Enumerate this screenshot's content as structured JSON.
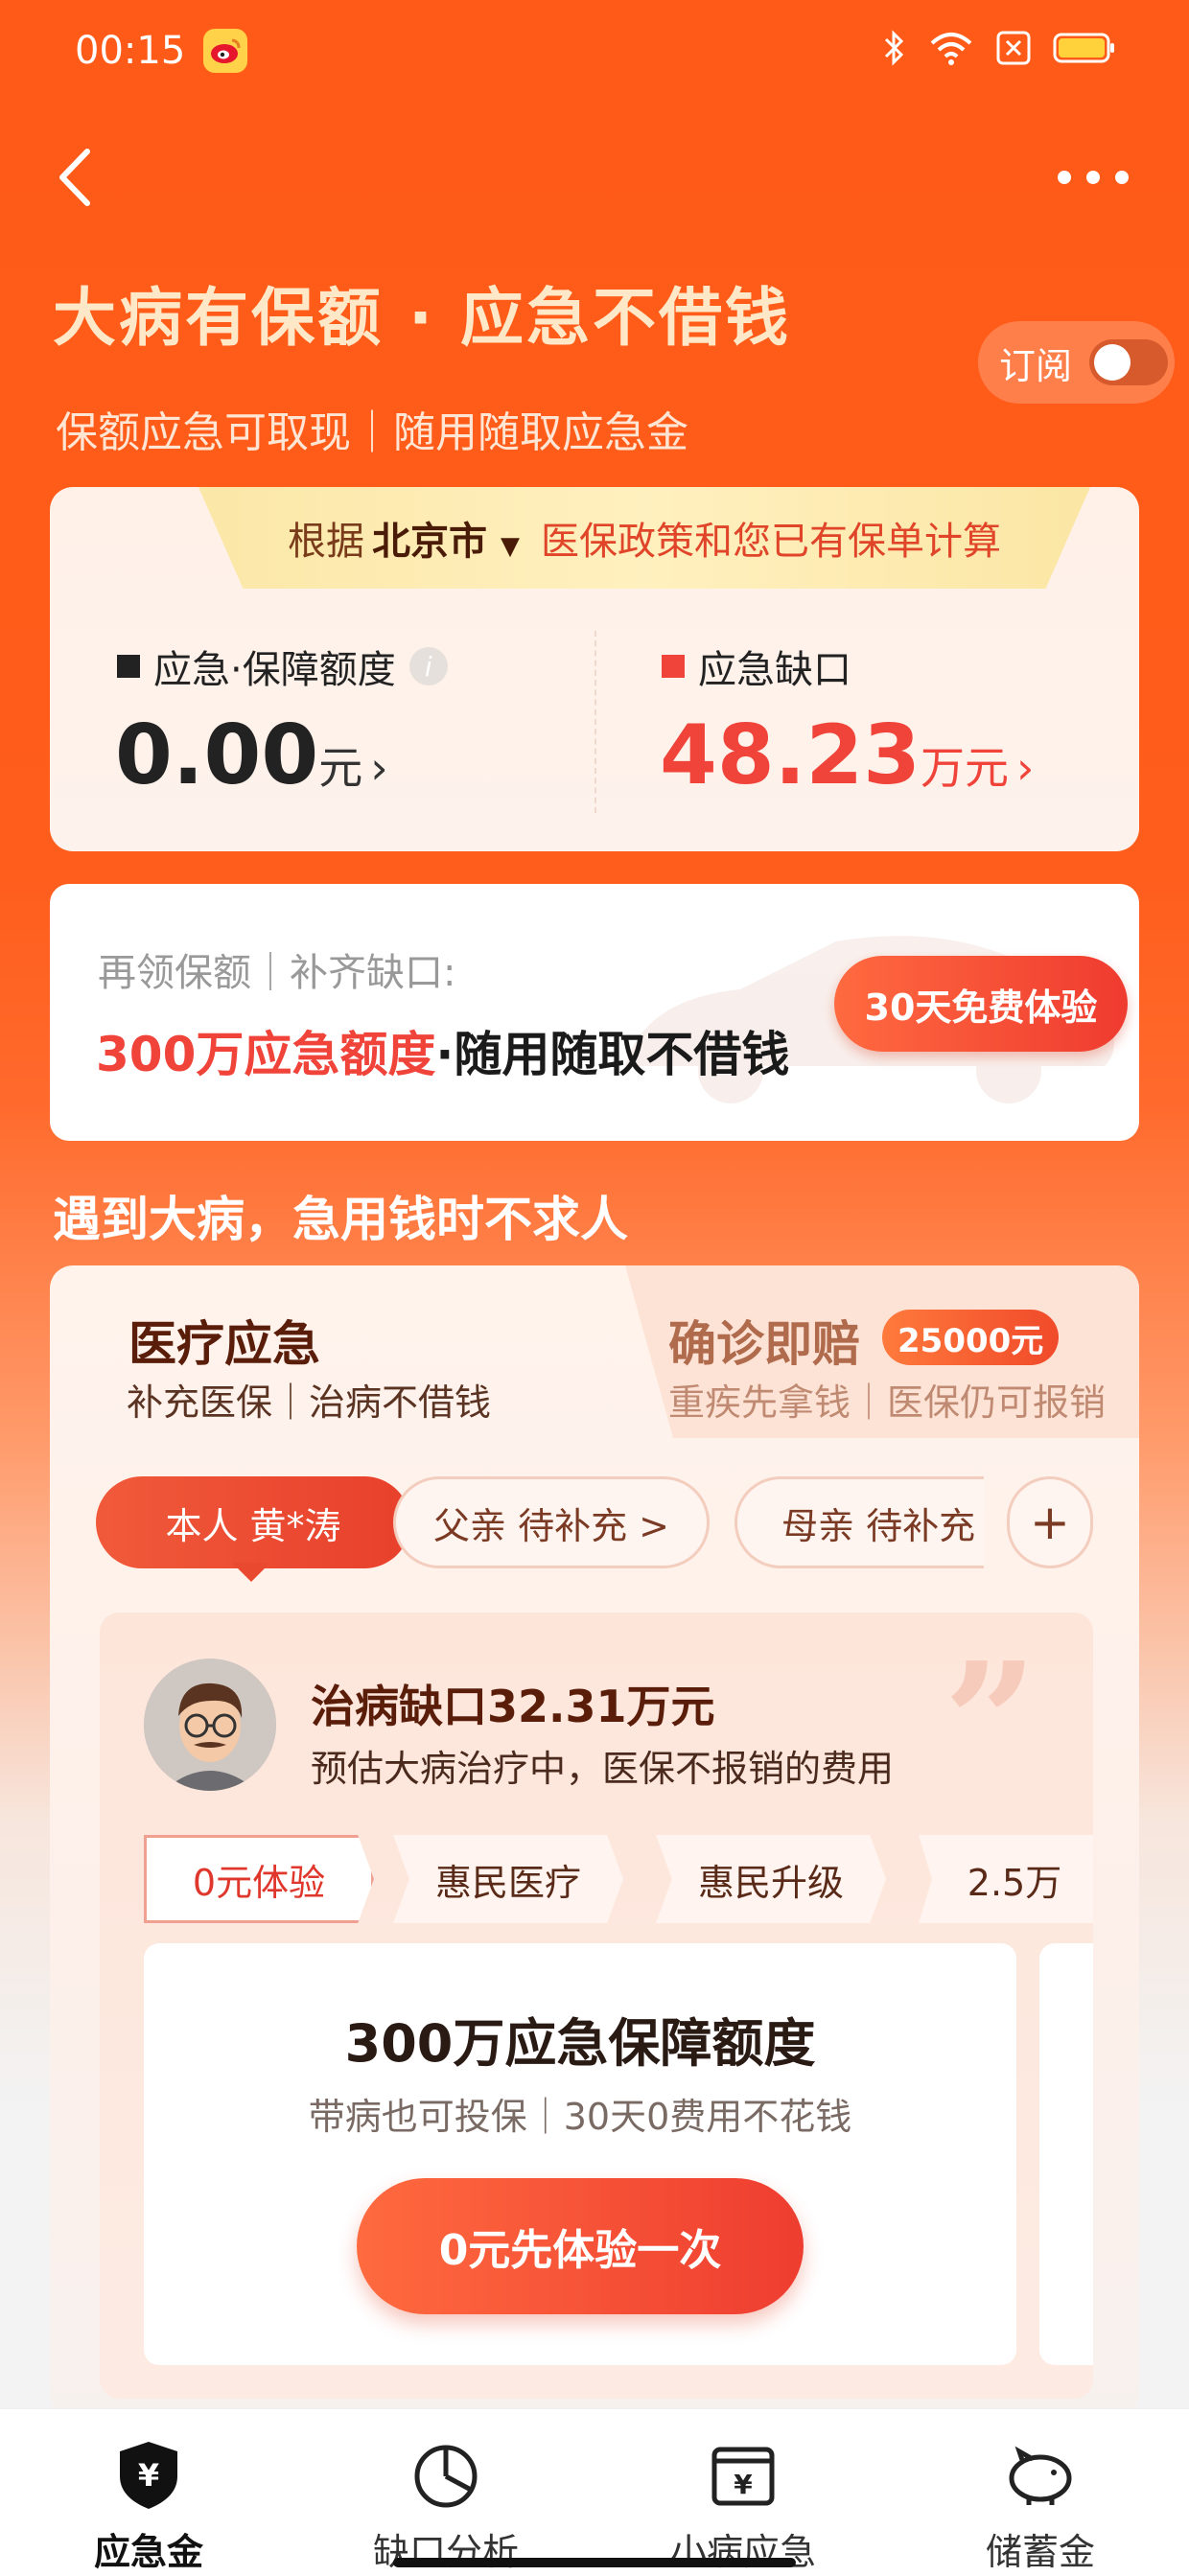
{
  "status_bar": {
    "time": "00:15",
    "icons": [
      "weibo-icon",
      "bluetooth-icon",
      "wifi-icon",
      "close-box-icon",
      "battery-icon"
    ]
  },
  "nav": {
    "back_icon": "chevron-left-icon",
    "more_icon": "ellipsis-icon"
  },
  "hero": {
    "title": "大病有保额 · 应急不借钱",
    "subtitle": "保额应急可取现｜随用随取应急金",
    "subscribe_label": "订阅",
    "subscribe_on": false
  },
  "summary": {
    "ribbon_prefix": "根据",
    "city": "北京市",
    "ribbon_suffix": "医保政策和您已有保单计算",
    "left_label": "应急·保障额度",
    "left_value": "0.00",
    "left_unit": "元",
    "right_label": "应急缺口",
    "right_value": "48.23",
    "right_unit": "万元"
  },
  "promo": {
    "subtitle": "再领保额｜补齐缺口:",
    "highlight": "300万应急额度",
    "rest": "·随用随取不借钱",
    "button": "30天免费体验"
  },
  "section_title": "遇到大病，急用钱时不求人",
  "tabs": {
    "left_title": "医疗应急",
    "left_sub": "补充医保｜治病不借钱",
    "right_title": "确诊即赔",
    "right_badge": "25000元",
    "right_sub": "重疾先拿钱｜医保仍可报销"
  },
  "people": [
    {
      "label": "本人 黄*涛"
    },
    {
      "label": "父亲 待补充 >"
    },
    {
      "label": "母亲 待补充"
    }
  ],
  "add_label": "+",
  "gap": {
    "title": "治病缺口32.31万元",
    "subtitle": "预估大病治疗中，医保不报销的费用"
  },
  "steps": [
    "0元体验",
    "惠民医疗",
    "惠民升级",
    "2.5万"
  ],
  "plan": {
    "title": "300万应急保障额度",
    "subtitle": "带病也可投保｜30天0费用不花钱",
    "button": "0元先体验一次"
  },
  "bottom_nav": [
    {
      "label": "应急金",
      "icon": "shield-yen-icon",
      "active": true
    },
    {
      "label": "缺口分析",
      "icon": "pie-chart-icon",
      "active": false
    },
    {
      "label": "小病应急",
      "icon": "yen-box-icon",
      "active": false
    },
    {
      "label": "储蓄金",
      "icon": "piggy-bank-icon",
      "active": false
    }
  ],
  "colors": {
    "brand": "#FF5A17",
    "accent_red": "#F0433A",
    "cream": "#FFE8C8"
  }
}
